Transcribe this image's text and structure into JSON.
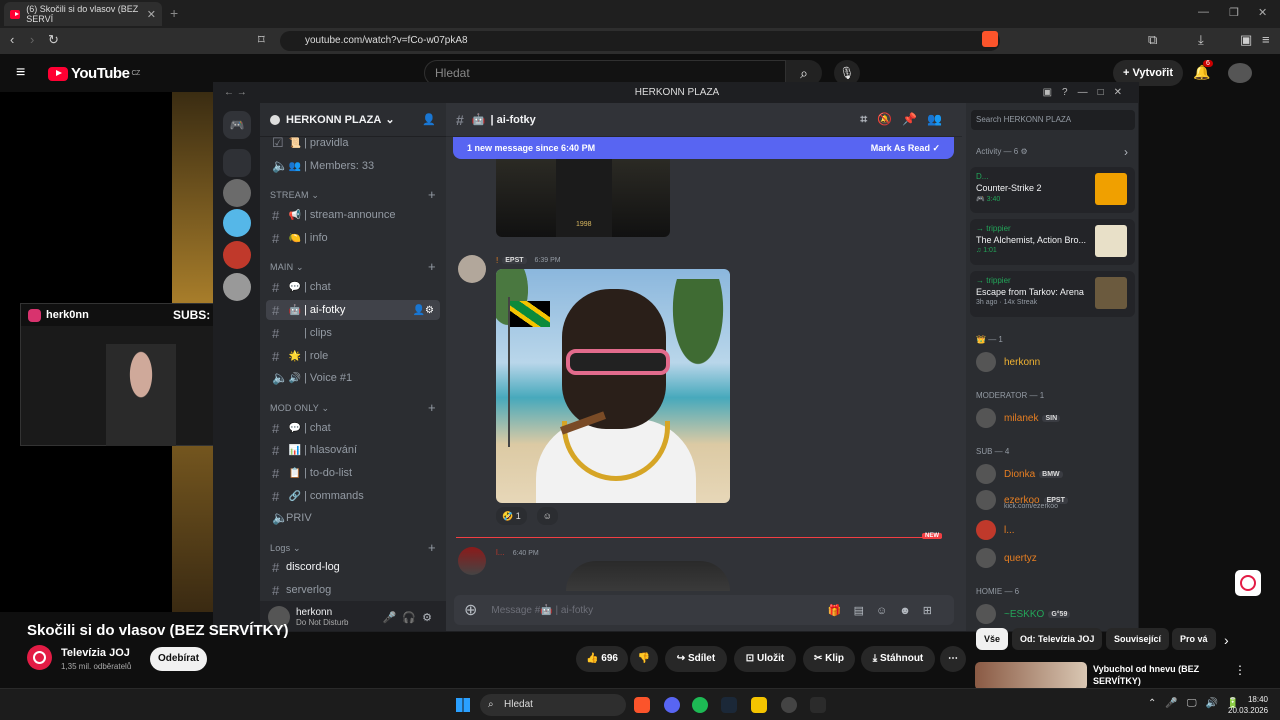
{
  "browser": {
    "tab_title": "(6) Skočili si do vlasov (BEZ SERVÍ",
    "url": "youtube.com/watch?v=fCo-w07pkA8"
  },
  "youtube": {
    "logo_text": "YouTube",
    "region": "CZ",
    "search_placeholder": "Hledat",
    "create_label": "Vytvořit",
    "notifications_count": "6",
    "video_title": "Skočili si do vlasov (BEZ SERVÍTKY)",
    "channel_name": "Televízia JOJ",
    "channel_subs": "1,35 mil. odběratelů",
    "subscribe_label": "Odebírat",
    "like_count": "696",
    "share_label": "Sdílet",
    "save_label": "Uložit",
    "clip_label": "Klip",
    "download_label": "Stáhnout",
    "chips": [
      "Vše",
      "Od: Televízia JOJ",
      "Související",
      "Pro vá"
    ],
    "recommended_title": "Vybuchol od hnevu (BEZ SERVÍTKY)"
  },
  "stream_overlay": {
    "handle": "herk0nn",
    "subs": "SUBS: 107/200"
  },
  "discord": {
    "window_title": "HERKONN PLAZA",
    "server_name": "HERKONN PLAZA",
    "channels_top": [
      {
        "icon": "📜",
        "name": "| pravidla",
        "type": "rules"
      },
      {
        "icon": "👥",
        "name": "| Members: 33",
        "type": "voice"
      }
    ],
    "categories": {
      "stream": "STREAM",
      "main": "MAIN",
      "mod_only": "MOD ONLY",
      "logs": "Logs"
    },
    "stream_channels": [
      {
        "icon": "📢",
        "name": "| stream-announce"
      },
      {
        "icon": "🍋",
        "name": "| info"
      }
    ],
    "main_channels": [
      {
        "icon": "💬",
        "name": "| chat"
      },
      {
        "icon": "🤖",
        "name": "| ai-fotky"
      },
      {
        "icon": "",
        "name": "| clips"
      },
      {
        "icon": "🌟",
        "name": "| role"
      },
      {
        "icon": "🔊",
        "name": "| Voice #1"
      }
    ],
    "mod_channels": [
      {
        "icon": "💬",
        "name": "| chat"
      },
      {
        "icon": "📊",
        "name": "| hlasování"
      },
      {
        "icon": "📋",
        "name": "| to-do-list"
      },
      {
        "icon": "🔗",
        "name": "| commands"
      },
      {
        "icon": "",
        "name": "PRIV"
      }
    ],
    "log_channels": [
      {
        "name": "discord-log"
      },
      {
        "name": "serverlog"
      }
    ],
    "user": {
      "name": "herkonn",
      "status": "Do Not Disturb"
    },
    "current_channel": "ai-fotky",
    "new_messages_banner": "1 new message since 6:40 PM",
    "mark_as_read": "Mark As Read",
    "msg1_caption": "1998",
    "msg2": {
      "name": "!",
      "tag": "EPST",
      "time": "6:39 PM",
      "reaction_count": "1"
    },
    "msg3": {
      "name": "l...",
      "time": "6:40 PM"
    },
    "new_label": "NEW",
    "composer_placeholder": "Message #🤖 | ai-fotky",
    "member_search": "Search HERKONN PLAZA",
    "activity_header": "Activity — 6",
    "activities": [
      {
        "user": "D...",
        "game": "Counter-Strike 2",
        "time": "3:40"
      },
      {
        "user": "trippier",
        "game": "The Alchemist, Action Bro...",
        "time": "1:01"
      },
      {
        "user": "trippier",
        "game": "Escape from Tarkov: Arena",
        "time": "3h ago · 14x Streak"
      }
    ],
    "groups": {
      "owner": "— 1",
      "moderator": "MODERATOR — 1",
      "sub": "SUB — 4",
      "homie": "HOMIE — 6"
    },
    "members_list": [
      {
        "name": "herkonn",
        "color": "#f0b232",
        "tag": ""
      },
      {
        "name": "milanek",
        "color": "#e67e22",
        "tag": "SIN"
      },
      {
        "name": "Dionka",
        "color": "#e67e22",
        "tag": "BMW"
      },
      {
        "name": "ezerkoo",
        "color": "#e67e22",
        "tag": "EPST",
        "sub": "kick.com/ezerkoo"
      },
      {
        "name": "l...",
        "color": "#e67e22",
        "tag": ""
      },
      {
        "name": "quertyz",
        "color": "#e67e22",
        "tag": ""
      },
      {
        "name": "~ESKKO",
        "color": "#23a559",
        "tag": "G°59"
      }
    ]
  },
  "taskbar": {
    "search_label": "Hledat",
    "time": "18:40",
    "date": "20.03.2026"
  }
}
